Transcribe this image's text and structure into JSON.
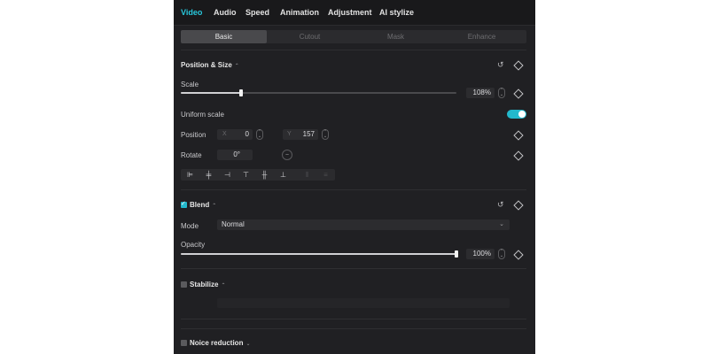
{
  "tabs": [
    "Video",
    "Audio",
    "Speed",
    "Animation",
    "Adjustment",
    "AI stylize"
  ],
  "subtabs": [
    "Basic",
    "Cutout",
    "Mask",
    "Enhance"
  ],
  "position_size": {
    "title": "Position & Size",
    "scale_label": "Scale",
    "scale_value": "108%",
    "scale_fraction": 0.22,
    "uniform_scale_label": "Uniform scale",
    "uniform_scale_on": true,
    "position_label": "Position",
    "x_label": "X",
    "x_value": "0",
    "y_label": "Y",
    "y_value": "157",
    "rotate_label": "Rotate",
    "rotate_value": "0°"
  },
  "blend": {
    "title": "Blend",
    "enabled": true,
    "mode_label": "Mode",
    "mode_value": "Normal",
    "opacity_label": "Opacity",
    "opacity_value": "100%",
    "opacity_fraction": 1.0
  },
  "stabilize": {
    "title": "Stabilize",
    "enabled": false
  },
  "noise_reduction": {
    "title": "Noice reduction",
    "enabled": false
  },
  "colors": {
    "accent": "#22b8cc",
    "panel": "#202023"
  }
}
